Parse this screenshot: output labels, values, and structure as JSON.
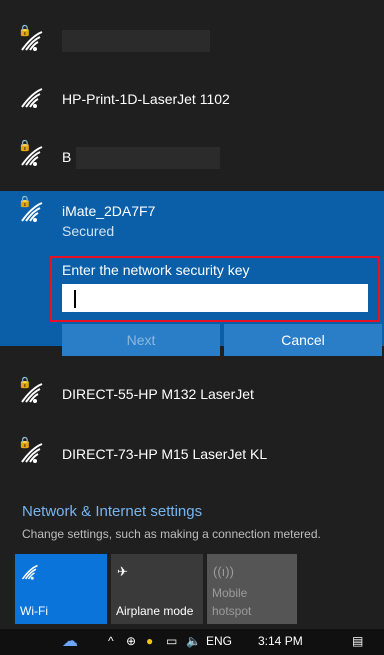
{
  "networks": {
    "n1": {
      "name": "",
      "secured": true
    },
    "n2": {
      "name": "HP-Print-1D-LaserJet 1102",
      "secured": false
    },
    "n3": {
      "name": "B",
      "secured": true
    },
    "selected": {
      "name": "iMate_2DA7F7",
      "status": "Secured",
      "key_label": "Enter the network security key",
      "key_value": "",
      "next_label": "Next",
      "cancel_label": "Cancel"
    },
    "n5": {
      "name": "DIRECT-55-HP M132 LaserJet",
      "secured": true
    },
    "n6": {
      "name": "DIRECT-73-HP M15 LaserJet KL",
      "secured": true
    }
  },
  "settings": {
    "title": "Network & Internet settings",
    "subtitle": "Change settings, such as making a connection metered."
  },
  "quick_actions": {
    "wifi": "Wi-Fi",
    "airplane": "Airplane mode",
    "hotspot_line1": "Mobile",
    "hotspot_line2": "hotspot"
  },
  "taskbar": {
    "language": "ENG",
    "time": "3:14 PM"
  },
  "colors": {
    "accent": "#0a5fa8",
    "link": "#77b5f2",
    "highlight_border": "#e81123"
  }
}
